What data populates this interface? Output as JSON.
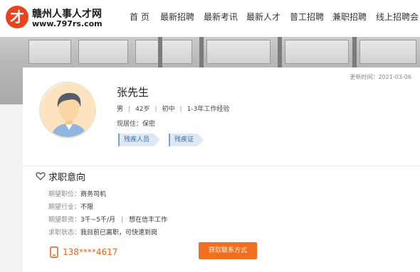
{
  "header": {
    "logo_title": "赣州人事人才网",
    "logo_url": "www.797rs.com",
    "nav": [
      "首 页",
      "最新招聘",
      "最新考讯",
      "最新人才",
      "普工招聘",
      "兼职招聘",
      "线上招聘会"
    ]
  },
  "profile": {
    "update_time": "更新时间：2021-03-06",
    "name": "张先生",
    "gender": "男",
    "age": "42岁",
    "education": "初中",
    "experience": "1-3年工作经验",
    "residence": "现居住：保密",
    "tags": [
      "残疾人员",
      "残疾证"
    ]
  },
  "intention": {
    "title": "求职意向",
    "rows": [
      {
        "label": "期望职位：",
        "value": "商务司机"
      },
      {
        "label": "期望行业：",
        "value": "不限"
      },
      {
        "label": "期望薪资：",
        "value": "3千~5千/月",
        "extra": "想在信丰工作"
      },
      {
        "label": "求职状态：",
        "value": "我目前已离职，可快速到岗"
      }
    ]
  },
  "contact": {
    "phone": "138****4617",
    "button": "获取联系方式"
  },
  "colors": {
    "accent": "#f36f20",
    "tag_bg": "#dde8f4",
    "tag_text": "#3a6da3"
  }
}
